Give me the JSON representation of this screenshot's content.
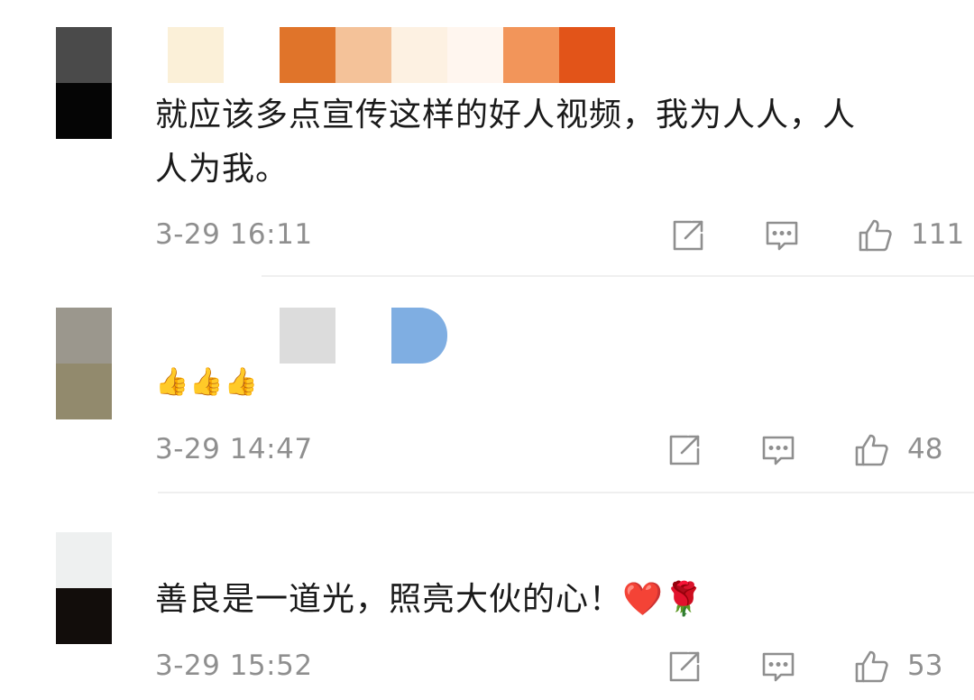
{
  "comments": [
    {
      "text_lines": [
        "就应该多点宣传这样的好人视频，我为人人，人",
        "人为我。"
      ],
      "time": "3-29 16:11",
      "likes": "111",
      "avatar_colors": [
        "#4a4a4a",
        "#050505"
      ],
      "name_swatches": [
        "#fbf0d8",
        "#ffffff",
        "#e0742a",
        "#f4c299",
        "#fdf1e2",
        "#fff6ef",
        "#f2955a",
        "#e25419"
      ]
    },
    {
      "text_lines": [
        "👍👍👍"
      ],
      "time": "3-29 14:47",
      "likes": "48",
      "avatar_colors": [
        "#9b978d",
        "#928a6d"
      ],
      "name_swatches": [
        "#dcdcdc",
        "#7faee2"
      ]
    },
    {
      "text_lines": [
        "善良是一道光，照亮大伙的心！❤️🌹"
      ],
      "time": "3-29 15:52",
      "likes": "53",
      "avatar_colors": [
        "#eef0f0",
        "#120d0b"
      ],
      "name_swatches": []
    }
  ],
  "icons": {
    "share": "share-icon",
    "reply": "comment-icon",
    "like": "thumbs-up-icon"
  }
}
